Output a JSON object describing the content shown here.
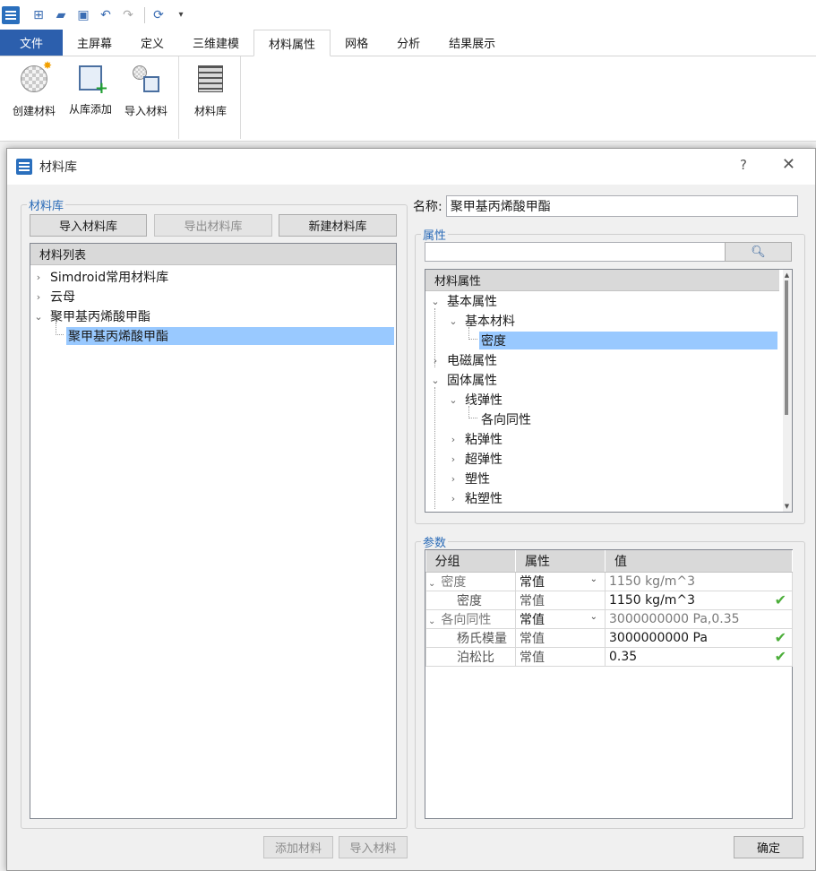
{
  "ribbon_tabs": {
    "file": "文件",
    "tabs": [
      "主屏幕",
      "定义",
      "三维建模",
      "材料属性",
      "网格",
      "分析",
      "结果展示"
    ]
  },
  "ribbon": {
    "create_material": "创建材料",
    "add_from_library": "从库添加",
    "import_material": "导入材料",
    "material_library": "材料库"
  },
  "dialog": {
    "title": "材料库",
    "help": "?",
    "close": "✕"
  },
  "library": {
    "legend": "材料库",
    "import_library": "导入材料库",
    "export_library": "导出材料库",
    "new_library": "新建材料库",
    "list_header": "材料列表",
    "items": [
      {
        "label": "Simdroid常用材料库",
        "state": "collapsed"
      },
      {
        "label": "云母",
        "state": "collapsed"
      },
      {
        "label": "聚甲基丙烯酸甲酯",
        "state": "expanded"
      },
      {
        "label": "聚甲基丙烯酸甲酯",
        "state": "selected-child"
      }
    ],
    "add_material": "添加材料",
    "import_material": "导入材料"
  },
  "name": {
    "label": "名称:",
    "value": "聚甲基丙烯酸甲酯"
  },
  "properties": {
    "legend": "属性",
    "search_value": "",
    "search_icon": "search-icon",
    "tree_header": "材料属性",
    "tree": [
      "基本属性",
      "基本材料",
      "密度",
      "电磁属性",
      "固体属性",
      "线弹性",
      "各向同性",
      "粘弹性",
      "超弹性",
      "塑性",
      "粘塑性"
    ]
  },
  "params": {
    "legend": "参数",
    "headers": [
      "分组",
      "属性",
      "值"
    ],
    "rows": [
      {
        "group": "密度",
        "attr": "常值",
        "value": "1150 kg/m^3"
      },
      {
        "group": "密度",
        "attr": "常值",
        "value": "1150 kg/m^3"
      },
      {
        "group": "各向同性",
        "attr": "常值",
        "value": "3000000000 Pa,0.35"
      },
      {
        "group": "杨氏模量",
        "attr": "常值",
        "value": "3000000000 Pa"
      },
      {
        "group": "泊松比",
        "attr": "常值",
        "value": "0.35"
      }
    ]
  },
  "ok": "确定",
  "colors": {
    "accent": "#2c5fad",
    "selection": "#99c9ff",
    "check": "#4cae3a"
  }
}
